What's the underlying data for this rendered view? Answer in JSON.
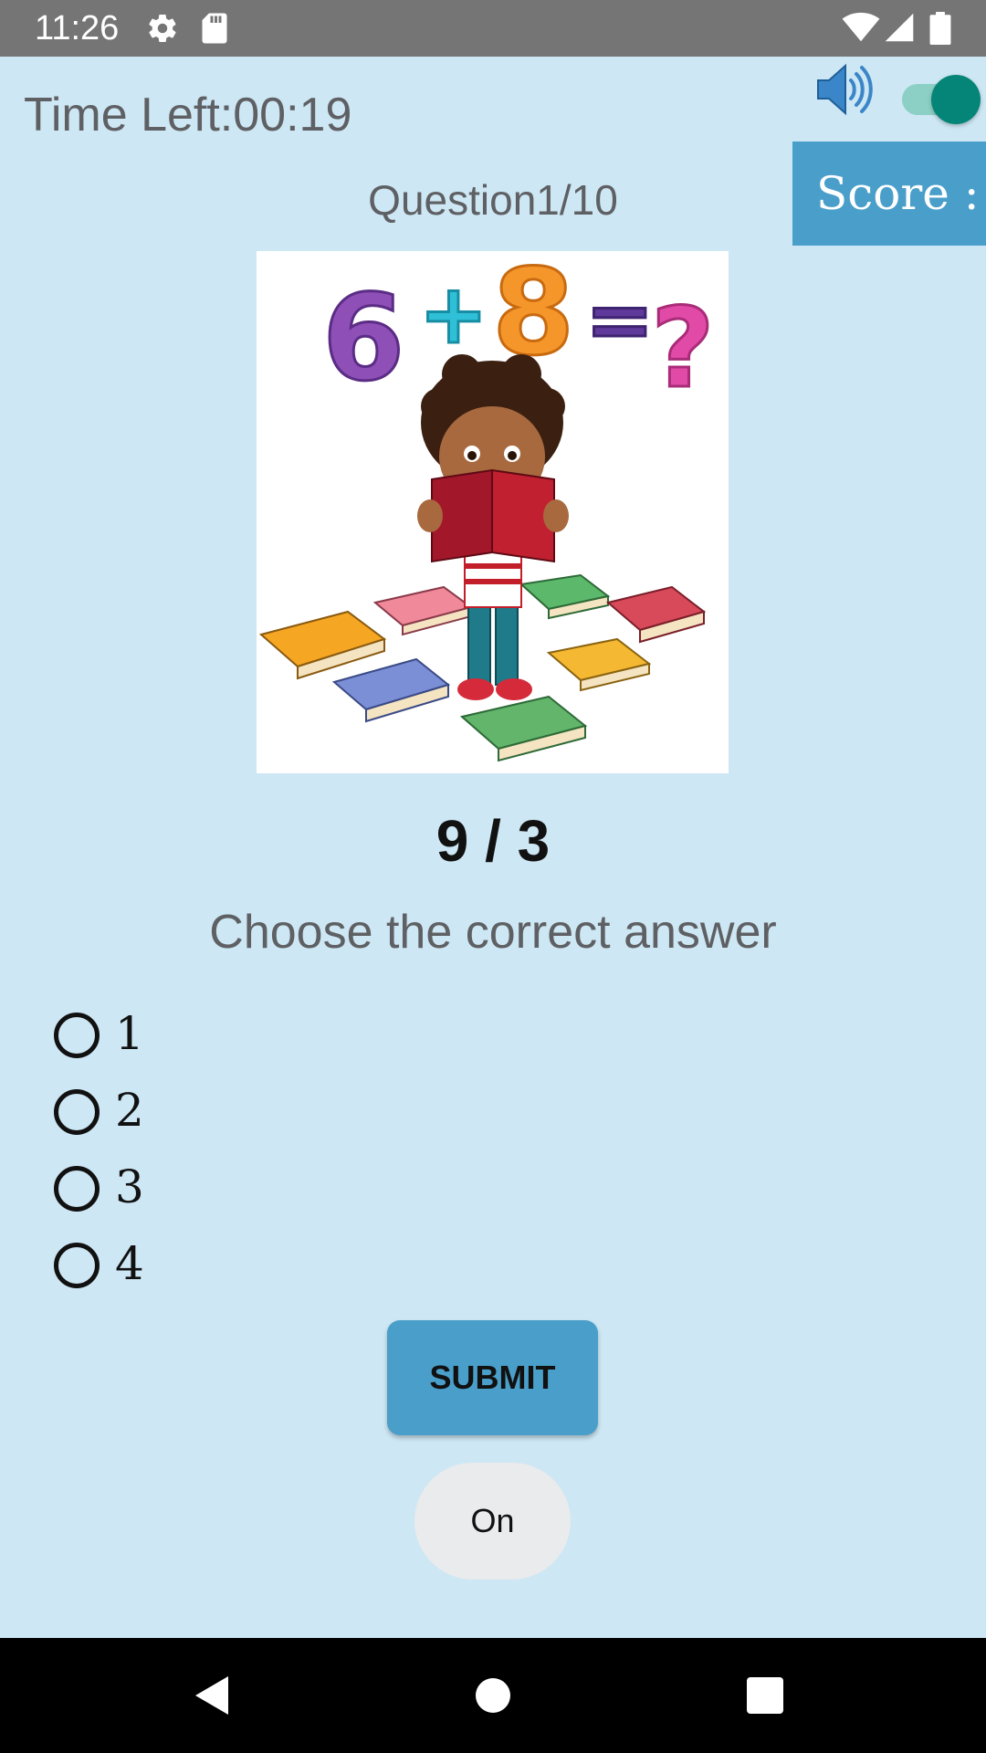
{
  "status_bar": {
    "time": "11:26",
    "icons": [
      "settings-icon",
      "sd-card-icon",
      "wifi-icon",
      "signal-icon",
      "battery-icon"
    ]
  },
  "header": {
    "timer_text": "Time Left:00:19",
    "sound_icon": "speaker-icon",
    "sound_switch_on": true,
    "score_label": "Score :"
  },
  "quiz": {
    "question_counter": "Question1/10",
    "expression": "9 / 3",
    "instruction": "Choose the correct answer",
    "options": [
      {
        "label": "1",
        "selected": false
      },
      {
        "label": "2",
        "selected": false
      },
      {
        "label": "3",
        "selected": false
      },
      {
        "label": "4",
        "selected": false
      }
    ],
    "submit_label": "SUBMIT",
    "toggle_label": "On"
  },
  "nav_bar": {
    "buttons": [
      "back-icon",
      "home-icon",
      "recents-icon"
    ]
  },
  "colors": {
    "background": "#cde7f4",
    "accent": "#4a9fca",
    "switch": "#058577"
  }
}
